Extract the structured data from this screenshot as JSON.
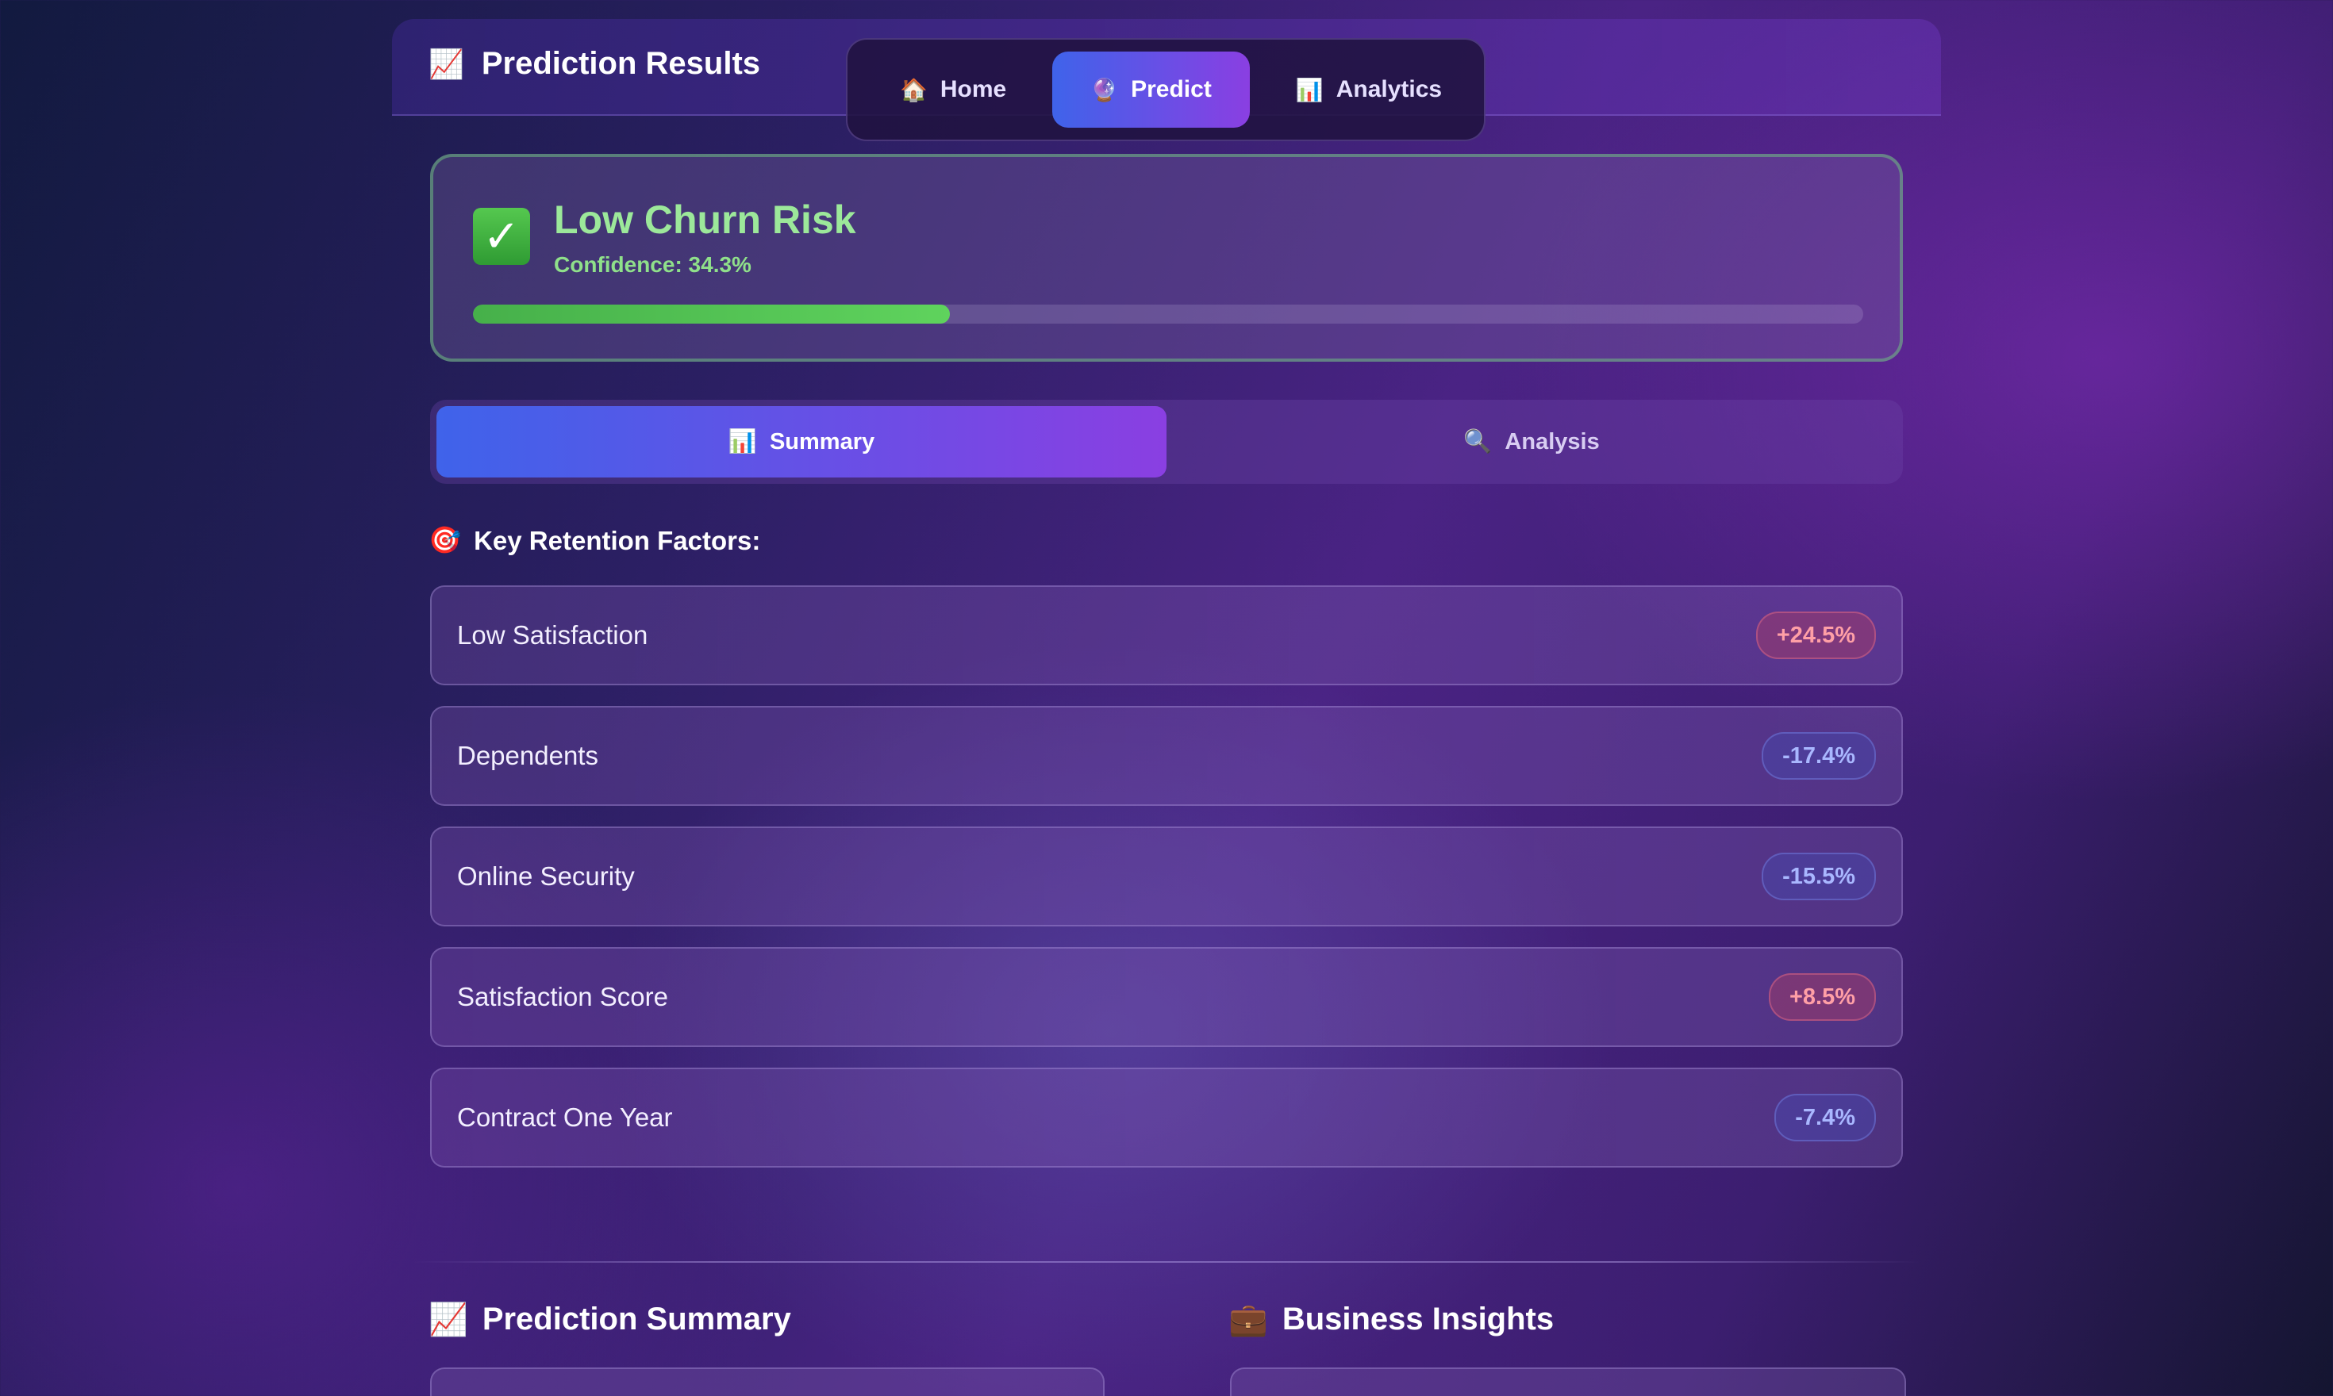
{
  "header": {
    "title": "Prediction Results",
    "icon": "chart-increasing-icon"
  },
  "nav": {
    "items": [
      {
        "label": "Home",
        "icon": "house-icon",
        "active": false
      },
      {
        "label": "Predict",
        "icon": "crystal-ball-icon",
        "active": true
      },
      {
        "label": "Analytics",
        "icon": "bar-chart-icon",
        "active": false
      }
    ]
  },
  "result": {
    "title": "Low Churn Risk",
    "confidence_text": "Confidence: 34.3%",
    "confidence_value": 34.3,
    "accent_color": "#9ce89a"
  },
  "tabs": [
    {
      "label": "Summary",
      "icon": "bar-chart-icon",
      "active": true
    },
    {
      "label": "Analysis",
      "icon": "magnifier-icon",
      "active": false
    }
  ],
  "factors": {
    "heading": "Key Retention Factors:",
    "items": [
      {
        "name": "Low Satisfaction",
        "impact": "+24.5%",
        "direction": "up"
      },
      {
        "name": "Dependents",
        "impact": "-17.4%",
        "direction": "down"
      },
      {
        "name": "Online Security",
        "impact": "-15.5%",
        "direction": "down"
      },
      {
        "name": "Satisfaction Score",
        "impact": "+8.5%",
        "direction": "up"
      },
      {
        "name": "Contract One Year",
        "impact": "-7.4%",
        "direction": "down"
      }
    ]
  },
  "sections": {
    "prediction_summary": "Prediction Summary",
    "business_insights": "Business Insights"
  },
  "colors": {
    "positive_impact": "#ff9fa6",
    "negative_impact": "#a9b7ff",
    "active_gradient_start": "#3f63ea",
    "active_gradient_end": "#8a3fe2"
  }
}
